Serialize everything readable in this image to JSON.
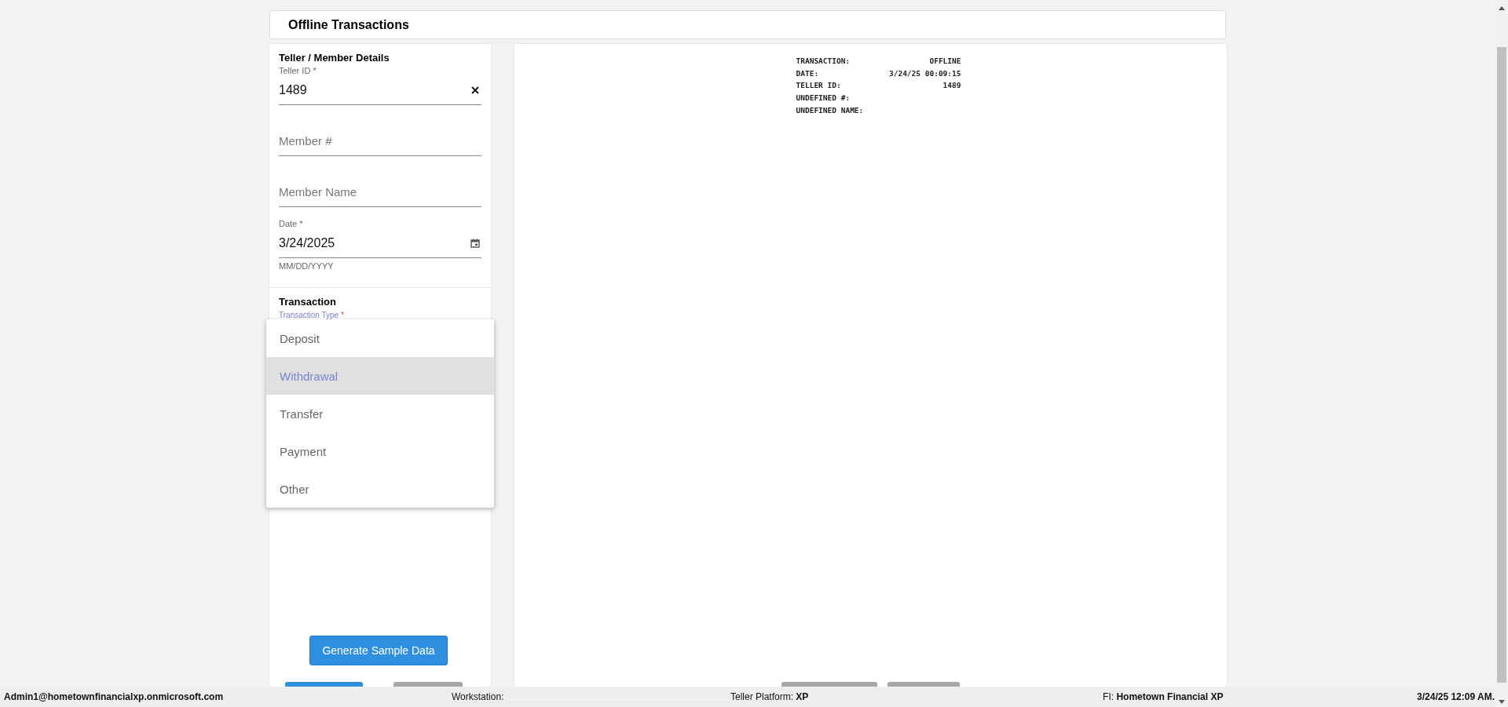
{
  "page_title": "Offline Transactions",
  "member_details": {
    "title": "Teller / Member Details",
    "fields": [
      {
        "kind": "text",
        "label": "Teller ID *",
        "value": "1489",
        "clearable": true
      },
      {
        "kind": "text",
        "placeholder": "Member #"
      },
      {
        "kind": "text",
        "placeholder": "Member Name"
      },
      {
        "kind": "date",
        "label": "Date *",
        "value": "3/24/2025",
        "hint": "MM/DD/YYYY"
      }
    ]
  },
  "transaction": {
    "title": "Transaction",
    "fields": [
      {
        "kind": "select",
        "label": "Transaction Type",
        "asterisk": "*",
        "focused": true
      }
    ]
  },
  "dropdown_menu": {
    "options": [
      {
        "label": "Deposit",
        "selected": false
      },
      {
        "label": "Withdrawal",
        "selected": true
      },
      {
        "label": "Transfer",
        "selected": false
      },
      {
        "label": "Payment",
        "selected": false
      },
      {
        "label": "Other",
        "selected": false
      }
    ]
  },
  "generate_button": "Generate Sample Data",
  "form_buttons": [
    {
      "kind": "primary"
    },
    {
      "kind": "secondary"
    }
  ],
  "receipt": {
    "lines": [
      {
        "label": "TRANSACTION:",
        "value": "OFFLINE"
      },
      {
        "label": "DATE:",
        "value": "3/24/25 00:09:15"
      },
      {
        "label": "TELLER ID:",
        "value": "1489"
      },
      {
        "label": "UNDEFINED #:"
      },
      {
        "label": "UNDEFINED NAME:"
      }
    ]
  },
  "receipt_buttons": [
    {
      "kind": "secondary"
    },
    {
      "kind": "secondary"
    }
  ],
  "status_bar": [
    "**Admin1@hometownfinancialxp.onmicrosoft.com**",
    "Workstation:",
    "Teller Platform: **XP**",
    "FI: **Hometown Financial XP**",
    "**3/24/25 12:09 AM.**"
  ]
}
